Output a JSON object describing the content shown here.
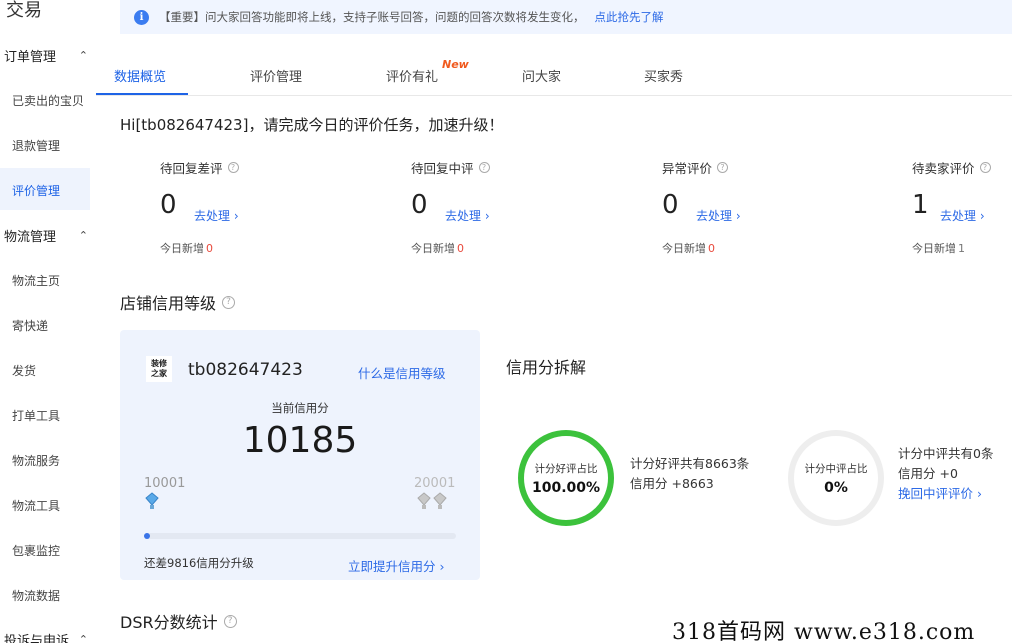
{
  "sidebar": {
    "top_title": "交易",
    "groups": [
      {
        "label": "订单管理",
        "items": [
          "已卖出的宝贝",
          "退款管理",
          "评价管理"
        ]
      },
      {
        "label": "物流管理",
        "items": [
          "物流主页",
          "寄快递",
          "发货",
          "打单工具",
          "物流服务",
          "物流工具",
          "包裹监控",
          "物流数据"
        ]
      },
      {
        "label": "投诉与申诉"
      }
    ],
    "active_item": "评价管理"
  },
  "notice": {
    "text": "【重要】问大家回答功能即将上线，支持子账号回答，问题的回答次数将发生变化，",
    "link": "点此抢先了解"
  },
  "tabs": [
    "数据概览",
    "评价管理",
    "评价有礼",
    "问大家",
    "买家秀"
  ],
  "new_badge": "New",
  "greeting": "Hi[tb082647423]，请完成今日的评价任务，加速升级！",
  "stats": [
    {
      "label": "待回复差评",
      "value": "0",
      "link": "去处理",
      "sub_label": "今日新增",
      "sub_value": "0"
    },
    {
      "label": "待回复中评",
      "value": "0",
      "link": "去处理",
      "sub_label": "今日新增",
      "sub_value": "0"
    },
    {
      "label": "异常评价",
      "value": "0",
      "link": "去处理",
      "sub_label": "今日新增",
      "sub_value": "0"
    },
    {
      "label": "待卖家评价",
      "value": "1",
      "link": "去处理",
      "sub_label": "今日新增",
      "sub_value": "1"
    }
  ],
  "credit_section_title": "店铺信用等级",
  "credit": {
    "logo_text": [
      "装修",
      "之家"
    ],
    "username": "tb082647423",
    "what_link": "什么是信用等级",
    "score_label": "当前信用分",
    "score": "10185",
    "range_min": "10001",
    "range_max": "20001",
    "progress_fraction": 0.0184,
    "remain_text": "还差9816信用分升级",
    "upgrade_link": "立即提升信用分"
  },
  "breakdown": {
    "title": "信用分拆解",
    "good": {
      "ring_label": "计分好评占比",
      "ring_value": "100.00%",
      "line1": "计分好评共有8663条",
      "line2": "信用分 +8663",
      "color": "#3cc23c"
    },
    "neutral": {
      "ring_label": "计分中评占比",
      "ring_value": "0%",
      "line1": "计分中评共有0条",
      "line2": "信用分 +0",
      "link": "挽回中评评价",
      "color": "#eeeeee"
    }
  },
  "dsr_title": "DSR分数统计",
  "watermark": "318首码网  www.e318.com",
  "colors": {
    "accent": "#1e63e6",
    "alert": "#e84a3d",
    "good_ring": "#3cc23c"
  }
}
